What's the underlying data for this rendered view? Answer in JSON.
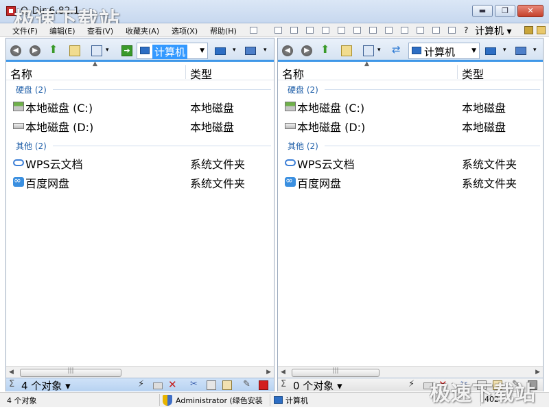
{
  "window": {
    "title": "Q-Dir 6.82.1",
    "watermark": "极速下载站",
    "buttons": {
      "minimize": "▬",
      "maximize": "❐",
      "close": "✕"
    }
  },
  "menu": {
    "items": [
      "文件(F)",
      "编辑(E)",
      "查看(V)",
      "收藏夹(A)",
      "选项(X)",
      "帮助(H)"
    ],
    "location_label": "计算机"
  },
  "left_pane": {
    "address": "计算机",
    "columns": {
      "name": "名称",
      "type": "类型"
    },
    "groups": [
      {
        "label": "硬盘 (2)",
        "rows": [
          {
            "icon": "local-drive-c-icon",
            "name": "本地磁盘 (C:)",
            "type": "本地磁盘"
          },
          {
            "icon": "local-drive-d-icon",
            "name": "本地磁盘 (D:)",
            "type": "本地磁盘"
          }
        ]
      },
      {
        "label": "其他 (2)",
        "rows": [
          {
            "icon": "wps-cloud-icon",
            "name": "WPS云文档",
            "type": "系统文件夹"
          },
          {
            "icon": "baidu-netdisk-icon",
            "name": "百度网盘",
            "type": "系统文件夹"
          }
        ]
      }
    ],
    "status": {
      "sigma": "Σ",
      "count": "4 个对象 ▾"
    }
  },
  "right_pane": {
    "address": "计算机",
    "columns": {
      "name": "名称",
      "type": "类型"
    },
    "groups": [
      {
        "label": "硬盘 (2)",
        "rows": [
          {
            "icon": "local-drive-c-icon",
            "name": "本地磁盘 (C:)",
            "type": "本地磁盘"
          },
          {
            "icon": "local-drive-d-icon",
            "name": "本地磁盘 (D:)",
            "type": "本地磁盘"
          }
        ]
      },
      {
        "label": "其他 (2)",
        "rows": [
          {
            "icon": "wps-cloud-icon",
            "name": "WPS云文档",
            "type": "系统文件夹"
          },
          {
            "icon": "baidu-netdisk-icon",
            "name": "百度网盘",
            "type": "系统文件夹"
          }
        ]
      }
    ],
    "status": {
      "sigma": "Σ",
      "count": "0 个对象 ▾"
    }
  },
  "statusbar": {
    "objects": "4 个对象",
    "user": "Administrator (绿色安装",
    "location": "计算机",
    "number": "402"
  },
  "colors": {
    "accent": "#3f97e8",
    "selection": "#3399ff",
    "group_text": "#1e5ea8"
  }
}
